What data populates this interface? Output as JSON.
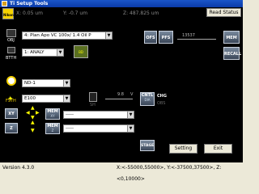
{
  "window": {
    "title": "Ti Setup Tools"
  },
  "coords": {
    "x": "X: 0.05 um",
    "y": "Y: -0.7 um",
    "z": "Z: 487.825 um"
  },
  "logo_text": "Nikon",
  "read_status_label": "Read Status",
  "objective": {
    "selected": "4: Plan Apo VC 100x/ 1.4 Oil P",
    "label": "OBJ"
  },
  "pfs": {
    "offs_label": "OFS",
    "pfs_label": "PFS",
    "value": "13537"
  },
  "mem_label": "MEM",
  "recall_label": "RECALL",
  "light_path": {
    "selected": "1: ANALY",
    "label": "BTTH"
  },
  "light_path_button": "BD",
  "filter": {
    "selected": "ND-1"
  },
  "epi_filter": {
    "selected": "E100",
    "label": "FSTH"
  },
  "shutter": {
    "label": "SH",
    "value": "9.8",
    "unit": "V"
  },
  "cntl": {
    "label": "CNTL",
    "sub": "DIA"
  },
  "chg": {
    "label": "CHG",
    "sub": "OBS"
  },
  "xy": {
    "label": "XY"
  },
  "z": {
    "label": "Z"
  },
  "xy_mem": {
    "label": "MEM",
    "sub": "XY",
    "selected": "-----"
  },
  "z_mem": {
    "label": "MEM",
    "sub": "Z",
    "selected": "-----"
  },
  "stage_label": "STAGE",
  "setting_label": "Setting",
  "exit_label": "Exit",
  "status": {
    "version": "Version 4.3.0",
    "limits": "X:<-55000,55000>, Y:<-37500,37500>, Z:<0,10000>"
  }
}
